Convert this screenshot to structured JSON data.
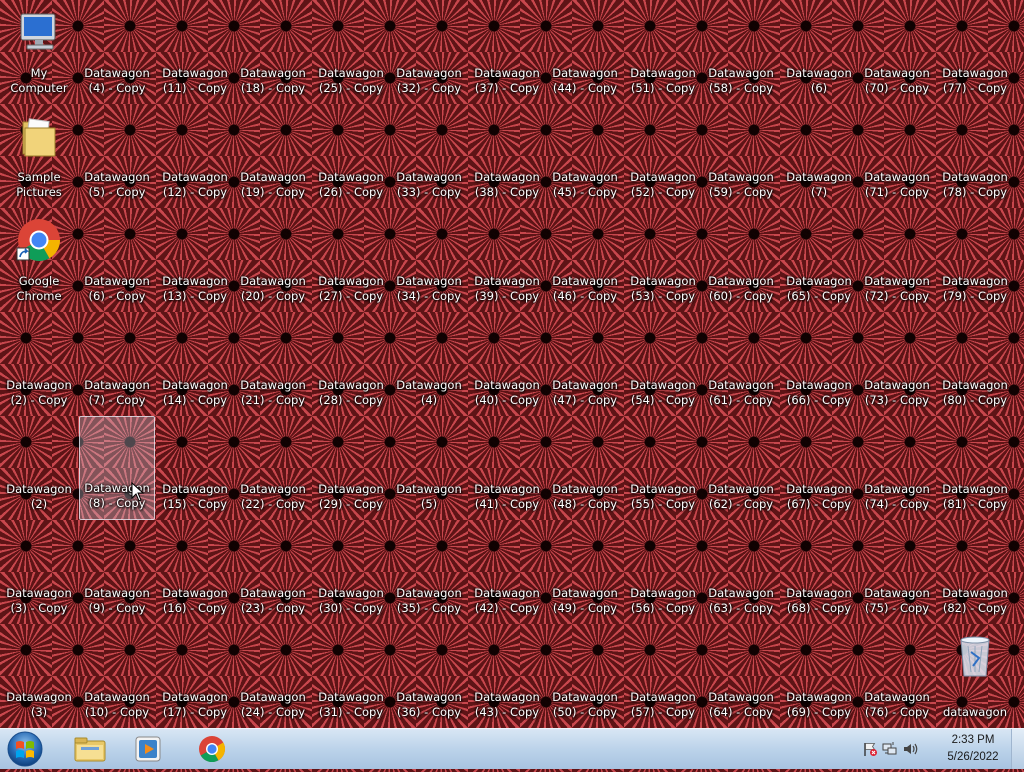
{
  "desktop": {
    "special_icons": {
      "my_computer": "My Computer",
      "sample_pictures": "Sample\nPictures",
      "google_chrome": "Google\nChrome",
      "recycle_bin": "datawagon"
    },
    "columns": [
      [
        "My Computer",
        "Sample\nPictures",
        "Google\nChrome",
        "Datawagon\n(2) - Copy",
        "Datawagon\n(2)",
        "Datawagon\n(3) - Copy",
        "Datawagon\n(3)"
      ],
      [
        "Datawagon\n(4) - Copy",
        "Datawagon\n(5) - Copy",
        "Datawagon\n(6) - Copy",
        "Datawagon\n(7) - Copy",
        "Datawagon\n(8) - Copy",
        "Datawagon\n(9) - Copy",
        "Datawagon\n(10) - Copy"
      ],
      [
        "Datawagon\n(11) - Copy",
        "Datawagon\n(12) - Copy",
        "Datawagon\n(13) - Copy",
        "Datawagon\n(14) - Copy",
        "Datawagon\n(15) - Copy",
        "Datawagon\n(16) - Copy",
        "Datawagon\n(17) - Copy"
      ],
      [
        "Datawagon\n(18) - Copy",
        "Datawagon\n(19) - Copy",
        "Datawagon\n(20) - Copy",
        "Datawagon\n(21) - Copy",
        "Datawagon\n(22) - Copy",
        "Datawagon\n(23) - Copy",
        "Datawagon\n(24) - Copy"
      ],
      [
        "Datawagon\n(25) - Copy",
        "Datawagon\n(26) - Copy",
        "Datawagon\n(27) - Copy",
        "Datawagon\n(28) - Copy",
        "Datawagon\n(29) - Copy",
        "Datawagon\n(30) - Copy",
        "Datawagon\n(31) - Copy"
      ],
      [
        "Datawagon\n(32) - Copy",
        "Datawagon\n(33) - Copy",
        "Datawagon\n(34) - Copy",
        "Datawagon\n(4)",
        "Datawagon\n(5)",
        "Datawagon\n(35) - Copy",
        "Datawagon\n(36) - Copy"
      ],
      [
        "Datawagon\n(37) - Copy",
        "Datawagon\n(38) - Copy",
        "Datawagon\n(39) - Copy",
        "Datawagon\n(40) - Copy",
        "Datawagon\n(41) - Copy",
        "Datawagon\n(42) - Copy",
        "Datawagon\n(43) - Copy"
      ],
      [
        "Datawagon\n(44) - Copy",
        "Datawagon\n(45) - Copy",
        "Datawagon\n(46) - Copy",
        "Datawagon\n(47) - Copy",
        "Datawagon\n(48) - Copy",
        "Datawagon\n(49) - Copy",
        "Datawagon\n(50) - Copy"
      ],
      [
        "Datawagon\n(51) - Copy",
        "Datawagon\n(52) - Copy",
        "Datawagon\n(53) - Copy",
        "Datawagon\n(54) - Copy",
        "Datawagon\n(55) - Copy",
        "Datawagon\n(56) - Copy",
        "Datawagon\n(57) - Copy"
      ],
      [
        "Datawagon\n(58) - Copy",
        "Datawagon\n(59) - Copy",
        "Datawagon\n(60) - Copy",
        "Datawagon\n(61) - Copy",
        "Datawagon\n(62) - Copy",
        "Datawagon\n(63) - Copy",
        "Datawagon\n(64) - Copy"
      ],
      [
        "Datawagon\n(6)",
        "Datawagon\n(7)",
        "Datawagon\n(65) - Copy",
        "Datawagon\n(66) - Copy",
        "Datawagon\n(67) - Copy",
        "Datawagon\n(68) - Copy",
        "Datawagon\n(69) - Copy"
      ],
      [
        "Datawagon\n(70) - Copy",
        "Datawagon\n(71) - Copy",
        "Datawagon\n(72) - Copy",
        "Datawagon\n(73) - Copy",
        "Datawagon\n(74) - Copy",
        "Datawagon\n(75) - Copy",
        "Datawagon\n(76) - Copy"
      ],
      [
        "Datawagon\n(77) - Copy",
        "Datawagon\n(78) - Copy",
        "Datawagon\n(79) - Copy",
        "Datawagon\n(80) - Copy",
        "Datawagon\n(81) - Copy",
        "Datawagon\n(82) - Copy",
        "datawagon"
      ]
    ],
    "selected_label": "Datawagon\n(8) - Copy"
  },
  "taskbar": {
    "pinned": [
      {
        "name": "windows-explorer",
        "icon": "folder-icon"
      },
      {
        "name": "media-player",
        "icon": "media-player-icon"
      },
      {
        "name": "google-chrome",
        "icon": "chrome-icon"
      }
    ],
    "tray_icons": [
      "action-center-flag-icon",
      "network-icon",
      "volume-icon"
    ],
    "clock": {
      "time": "2:33 PM",
      "date": "5/26/2022"
    }
  },
  "colors": {
    "wallpaper_red": "#c8474d",
    "wallpaper_dark": "#0a0000",
    "taskbar": "#bcd3ea"
  }
}
